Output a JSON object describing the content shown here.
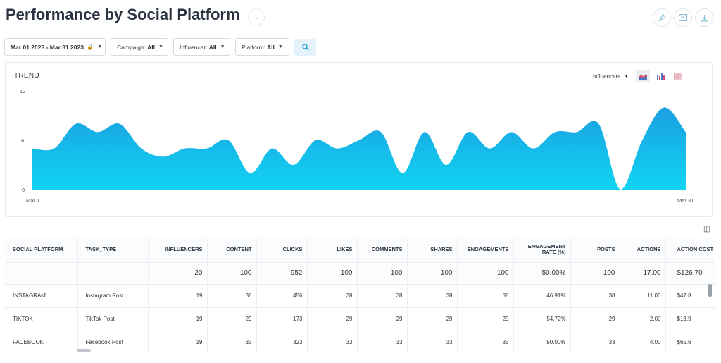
{
  "page": {
    "title": "Performance by Social Platform",
    "icons": [
      "chevron-down-icon",
      "pin-icon",
      "email-icon",
      "download-icon"
    ]
  },
  "filters": {
    "date_range": "Mar 01 2023 - Mar 31 2023",
    "campaign_label": "Campaign:",
    "campaign_value": "All",
    "influencer_label": "Influencer:",
    "influencer_value": "All",
    "platform_label": "Platform:",
    "platform_value": "All"
  },
  "chart": {
    "label": "TREND",
    "metric_select": "Influencers",
    "chart_types": [
      "area",
      "bar",
      "table"
    ]
  },
  "chart_data": {
    "type": "area",
    "title": "TREND",
    "x_start_label": "Mar 1",
    "x_end_label": "Mar 31",
    "ylim": [
      0,
      12
    ],
    "yticks": [
      "0",
      "6",
      "12"
    ],
    "grid": false,
    "color": "#1ab3e6",
    "series": [
      {
        "values": [
          5,
          5,
          8,
          7,
          8,
          5,
          4,
          5,
          5,
          6,
          2,
          5,
          3,
          6,
          5,
          6,
          7,
          2,
          7,
          3,
          7,
          5,
          7,
          5,
          7,
          7,
          8,
          0,
          6,
          10,
          7
        ]
      }
    ]
  },
  "table": {
    "columns": [
      "SOCIAL PLATFORM",
      "TASK_TYPE",
      "INFLUENCERS",
      "CONTENT",
      "CLICKS",
      "LIKES",
      "COMMENTS",
      "SHARES",
      "ENGAGEMENTS",
      "ENGAGEMENT RATE (%)",
      "POSTS",
      "ACTIONS",
      "ACTION COST"
    ],
    "totals": [
      "",
      "",
      "20",
      "100",
      "952",
      "100",
      "100",
      "100",
      "100",
      "50.00%",
      "100",
      "17.00",
      "$126.70"
    ],
    "rows": [
      [
        "INSTAGRAM",
        "Instagram Post",
        "19",
        "38",
        "456",
        "38",
        "38",
        "38",
        "38",
        "46.91%",
        "38",
        "11.00",
        "$47.8"
      ],
      [
        "TIKTOK",
        "TikTok Post",
        "19",
        "29",
        "173",
        "29",
        "29",
        "29",
        "29",
        "54.72%",
        "29",
        "2.00",
        "$13.9"
      ],
      [
        "FACEBOOK",
        "Facebook Post",
        "19",
        "33",
        "323",
        "33",
        "33",
        "33",
        "33",
        "50.00%",
        "33",
        "4.00",
        "$65.6"
      ]
    ]
  },
  "colors": {
    "accent": "#1ab3e6",
    "accent_light": "#e4f3fb"
  }
}
